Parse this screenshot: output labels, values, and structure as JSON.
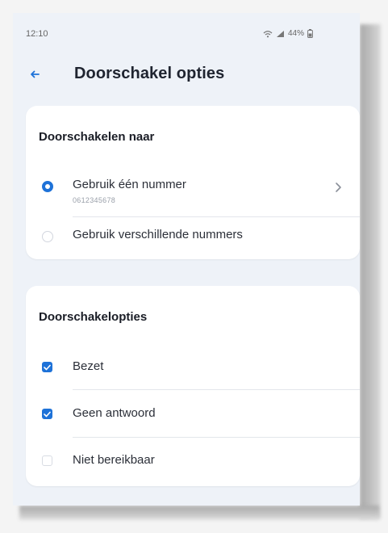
{
  "status_bar": {
    "time": "12:10",
    "battery": "44%"
  },
  "header": {
    "title": "Doorschakel opties"
  },
  "forward_to": {
    "title": "Doorschakelen naar",
    "options": [
      {
        "label": "Gebruik één nummer",
        "sublabel": "0612345678",
        "selected": true
      },
      {
        "label": "Gebruik verschillende nummers",
        "selected": false
      }
    ]
  },
  "forward_options": {
    "title": "Doorschakelopties",
    "items": [
      {
        "label": "Bezet",
        "checked": true
      },
      {
        "label": "Geen antwoord",
        "checked": true
      },
      {
        "label": "Niet bereikbaar",
        "checked": false
      }
    ]
  },
  "colors": {
    "accent": "#1e72d8",
    "background": "#eef2f8",
    "card": "#ffffff",
    "text": "#1f2430"
  }
}
